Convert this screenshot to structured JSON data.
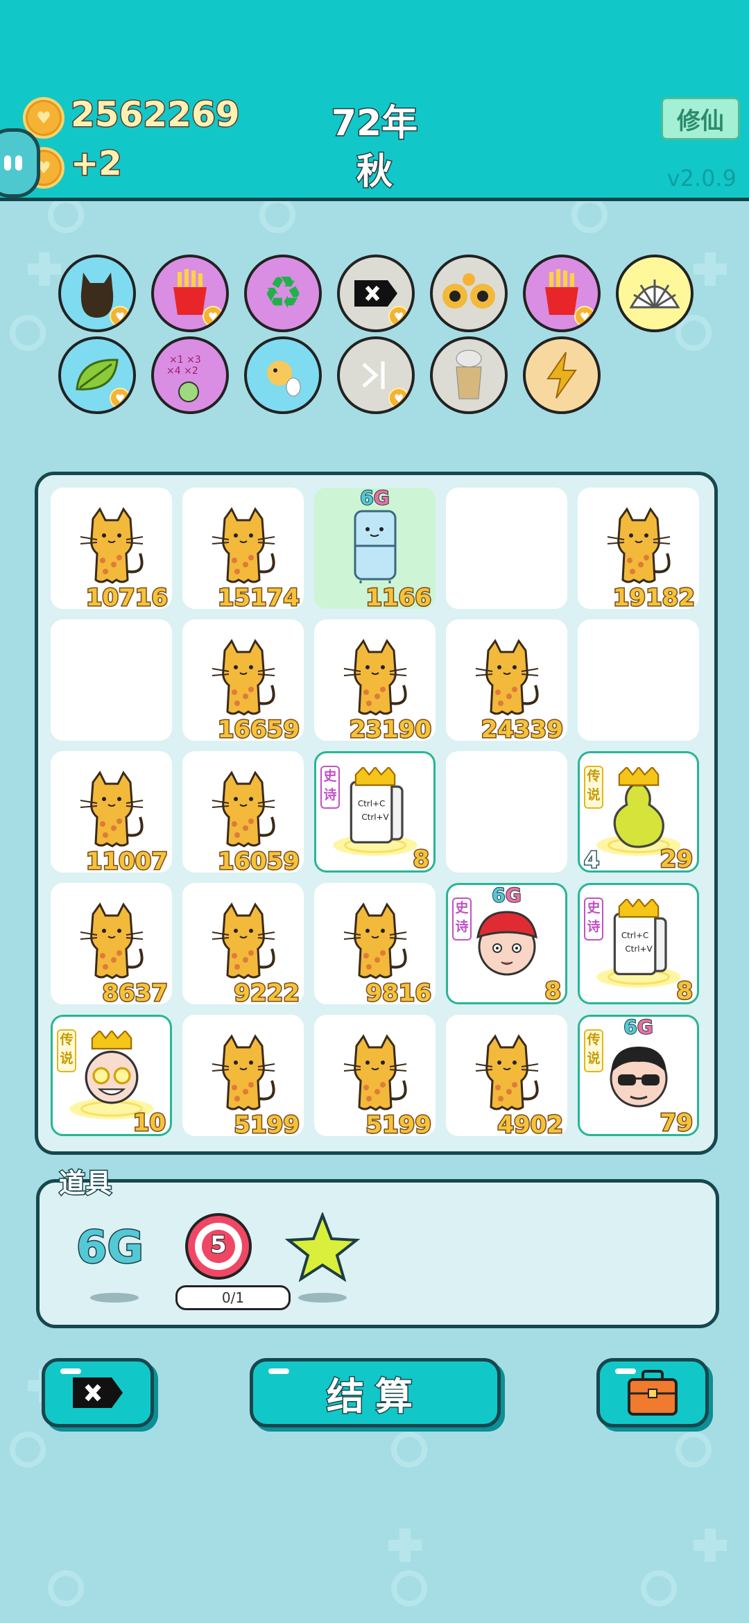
{
  "header": {
    "coins": "2562269",
    "income": "+2",
    "year": "72年",
    "season": "秋",
    "cultivate_label": "修仙",
    "version": "v2.0.9"
  },
  "buffs": [
    {
      "icon": "cat-silhouette-icon"
    },
    {
      "icon": "fries-icon"
    },
    {
      "icon": "recycle-icon"
    },
    {
      "icon": "delete-tag-icon"
    },
    {
      "icon": "cat-eyes-icon"
    },
    {
      "icon": "fries-icon"
    },
    {
      "icon": "shell-icon"
    },
    {
      "icon": "leaf-icon"
    },
    {
      "icon": "math-head-icon"
    },
    {
      "icon": "chick-egg-icon"
    },
    {
      "icon": "skip-icon"
    },
    {
      "icon": "milk-tea-icon"
    },
    {
      "icon": "lightning-icon"
    }
  ],
  "board": {
    "tiles": [
      {
        "type": "cat",
        "value": "10716"
      },
      {
        "type": "cat",
        "value": "15174"
      },
      {
        "type": "fridge",
        "value": "1166",
        "badge": "6G",
        "green": true
      },
      {
        "type": "empty"
      },
      {
        "type": "cat",
        "value": "19182"
      },
      {
        "type": "empty"
      },
      {
        "type": "cat",
        "value": "16659"
      },
      {
        "type": "cat",
        "value": "23190"
      },
      {
        "type": "cat",
        "value": "24339"
      },
      {
        "type": "empty"
      },
      {
        "type": "cat",
        "value": "11007"
      },
      {
        "type": "cat",
        "value": "16059"
      },
      {
        "type": "copypaste",
        "value": "8",
        "tag": "史诗",
        "rarity": "epic",
        "copy": "Ctrl+C",
        "paste": "Ctrl+V"
      },
      {
        "type": "empty"
      },
      {
        "type": "pear",
        "value": "29",
        "count": "4",
        "tag": "传说",
        "rarity": "legend"
      },
      {
        "type": "cat",
        "value": "8637"
      },
      {
        "type": "cat",
        "value": "9222"
      },
      {
        "type": "cat",
        "value": "9816"
      },
      {
        "type": "redhat",
        "value": "8",
        "tag": "史诗",
        "rarity": "epic",
        "badge": "6G"
      },
      {
        "type": "copypaste",
        "value": "8",
        "tag": "史诗",
        "rarity": "epic",
        "copy": "Ctrl+C",
        "paste": "Ctrl+V"
      },
      {
        "type": "oldking",
        "value": "10",
        "tag": "传说",
        "rarity": "legend"
      },
      {
        "type": "cat",
        "value": "5199"
      },
      {
        "type": "cat",
        "value": "5199"
      },
      {
        "type": "cat",
        "value": "4902"
      },
      {
        "type": "sunglasses",
        "value": "79",
        "tag": "传说",
        "rarity": "legend",
        "badge": "6G"
      }
    ]
  },
  "props": {
    "label": "道具",
    "items": [
      {
        "name": "6g-item",
        "text": "6G"
      },
      {
        "name": "target-item",
        "text": "5",
        "counter": "0/1"
      },
      {
        "name": "star-item"
      }
    ]
  },
  "actions": {
    "settle_label": "结算"
  },
  "colors": {
    "header": "#12c7c8",
    "background": "#a6dde4",
    "outline": "#17474d",
    "tile_number": "#f4c33a",
    "epic": "#c052c4",
    "legend": "#e0b818"
  }
}
